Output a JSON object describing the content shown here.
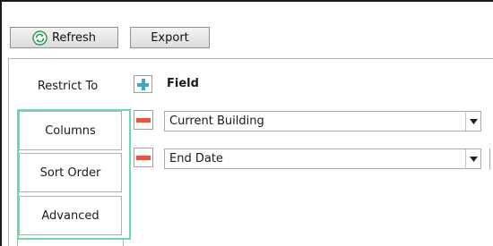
{
  "toolbar": {
    "refresh_label": "Refresh",
    "export_label": "Export"
  },
  "tabs": {
    "restrict_to": "Restrict To",
    "columns": "Columns",
    "sort_order": "Sort Order",
    "advanced": "Advanced",
    "active_highlight_color": "#66dca6"
  },
  "columns": {
    "header": "Field",
    "add_icon": "plus-icon",
    "remove_icon": "minus-icon",
    "rows": [
      {
        "value": "Current Building"
      },
      {
        "value": "End Date"
      }
    ]
  },
  "colors": {
    "add": "#3fa6c9",
    "remove": "#e8553e",
    "refresh_icon": "#2e9e57"
  }
}
